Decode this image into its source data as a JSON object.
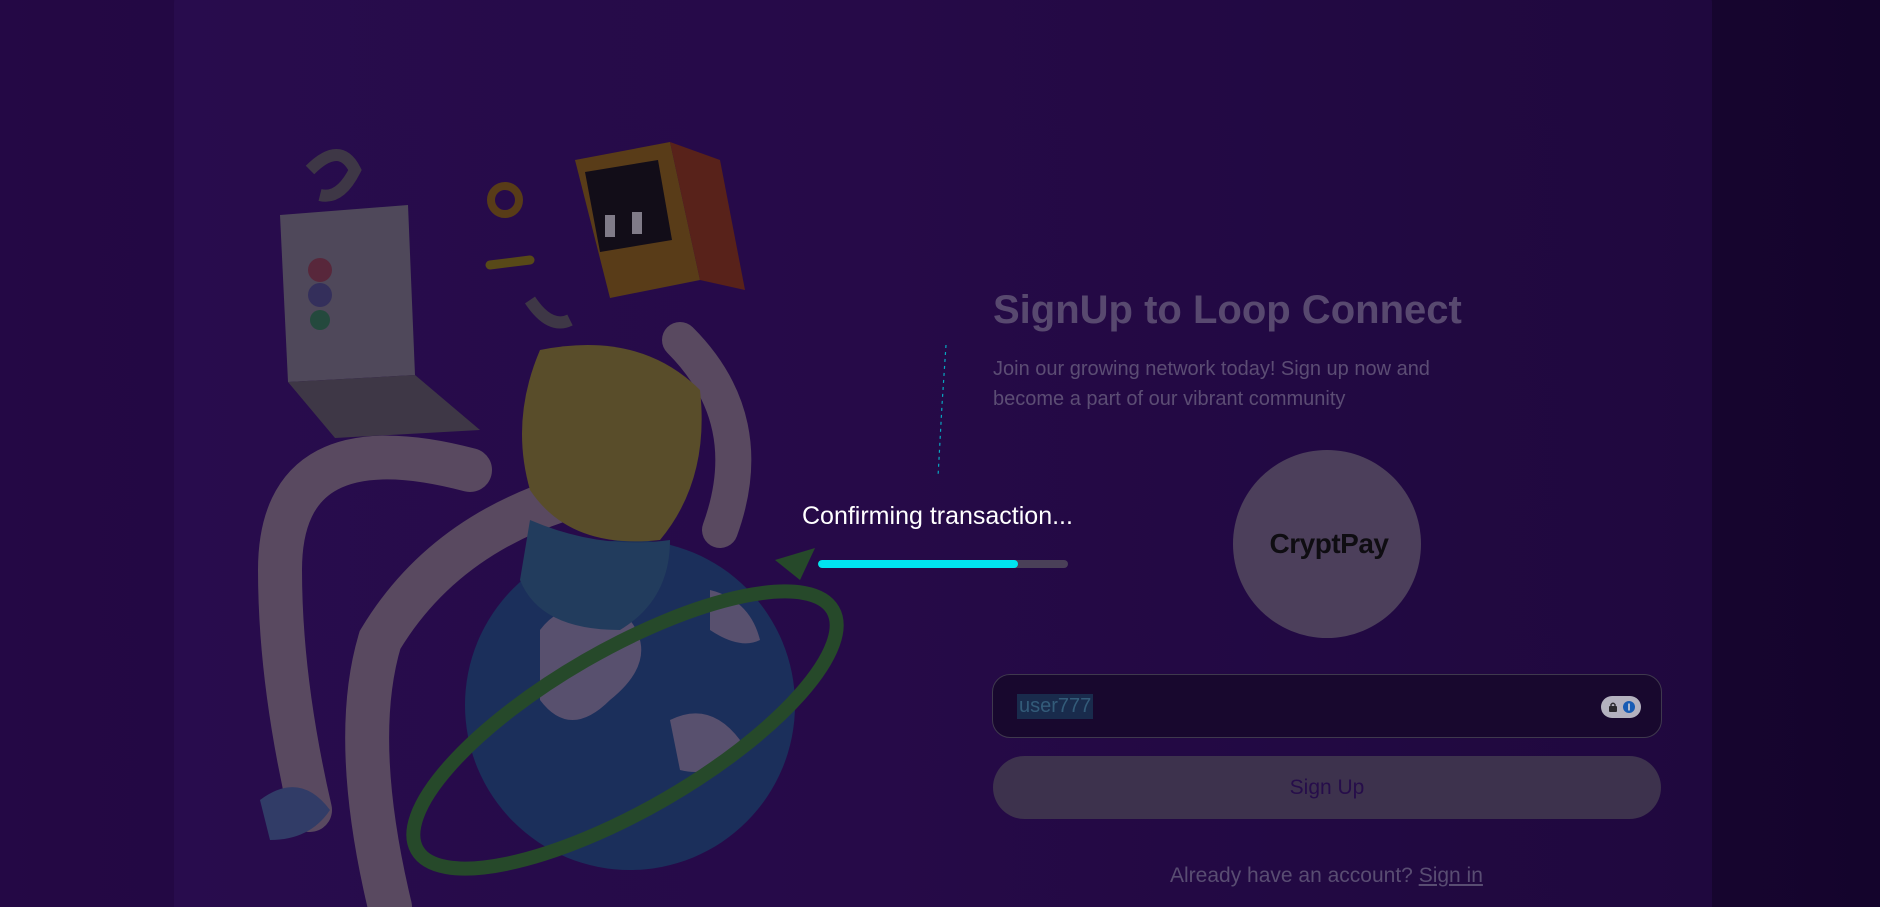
{
  "signup": {
    "title": "SignUp to Loop Connect",
    "subtitle": "Join our growing network today! Sign up now and become a part of our vibrant community",
    "logo_text": "CryptPay",
    "username_value": "user777",
    "signup_button_label": "Sign Up",
    "signin_prompt": "Already have an account?",
    "signin_link": "Sign in"
  },
  "overlay": {
    "message": "Confirming transaction...",
    "progress_fraction": 0.8,
    "progress_color": "#00e5f0"
  },
  "colors": {
    "background": "#2a0a4f",
    "accent": "#00e5f0"
  },
  "icons": {
    "password_manager": "password-manager-icon"
  }
}
